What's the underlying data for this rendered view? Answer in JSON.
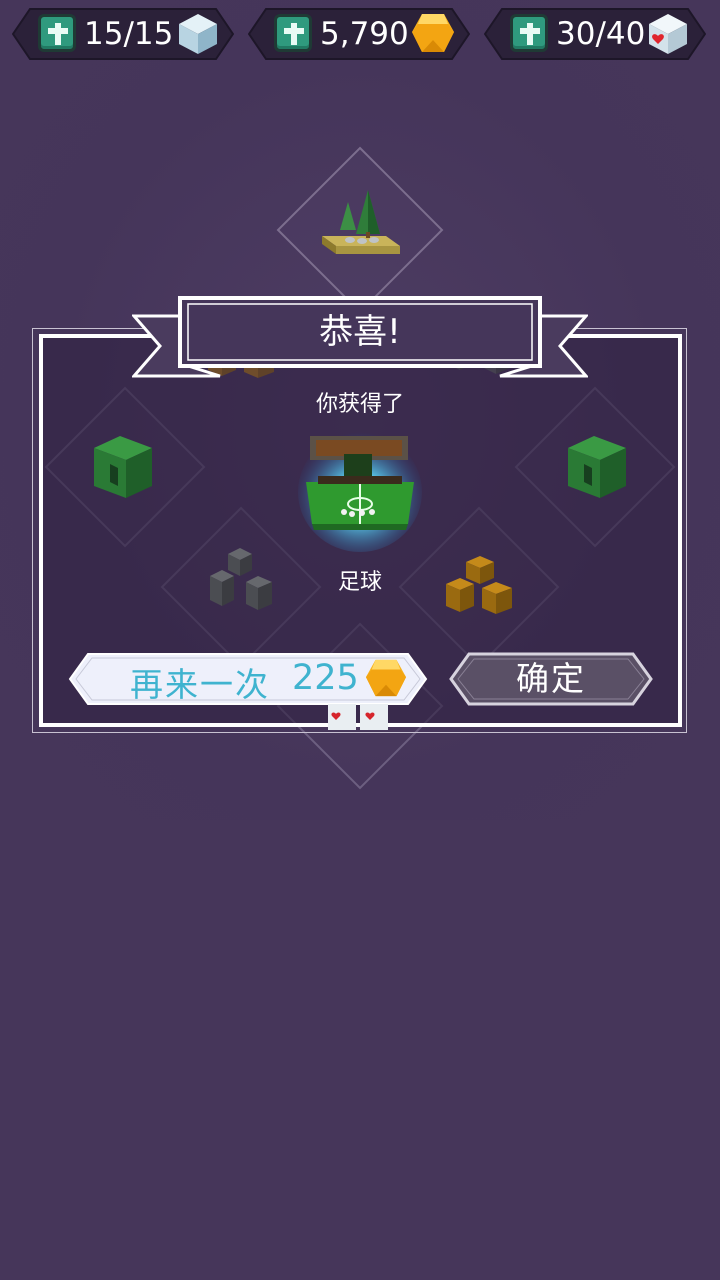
{
  "resources": [
    {
      "name": "ice-cube",
      "value": "15/15",
      "icon": "ice-cube-icon",
      "color": "#b9d8e6"
    },
    {
      "name": "gold",
      "value": "5,790",
      "icon": "gold-gem-icon",
      "color": "#f7b21e"
    },
    {
      "name": "heart-cube",
      "value": "30/40",
      "icon": "heart-cube-icon",
      "color": "#d9e7ef"
    }
  ],
  "dialog": {
    "title": "恭喜!",
    "subtitle": "你获得了",
    "reward_name": "足球",
    "retry_label": "再来一次",
    "retry_cost": "225",
    "confirm_label": "确定"
  },
  "colors": {
    "background": "#46365a",
    "accent_teal": "#2f9a7e",
    "retry_text": "#3fb3cf",
    "gold": "#f7b21e"
  }
}
